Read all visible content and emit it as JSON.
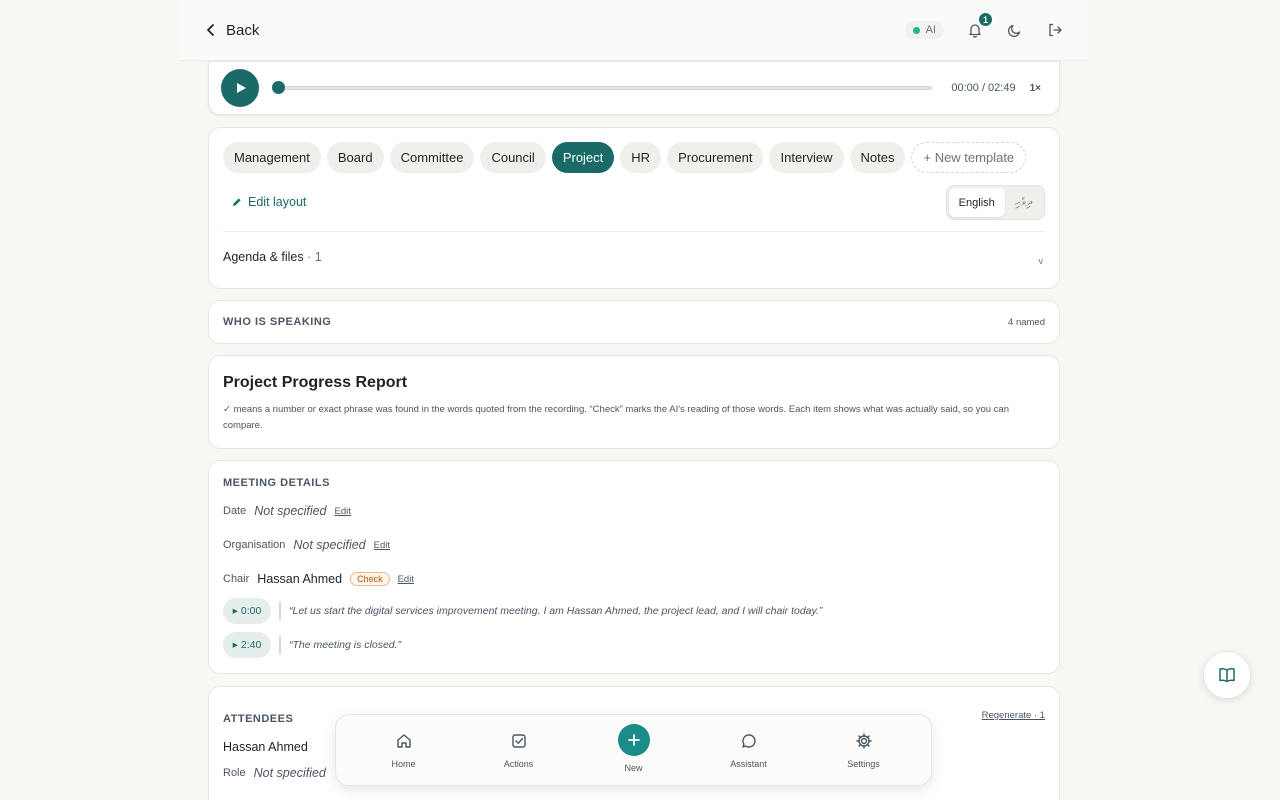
{
  "topbar": {
    "back_label": "Back",
    "ai_label": "AI",
    "notification_count": "1",
    "icons": [
      "bell-icon",
      "moon-icon",
      "logout-icon"
    ]
  },
  "player": {
    "time": "00:00 / 02:49",
    "speed": "1×",
    "progress": 0
  },
  "templates": {
    "chips": [
      "Management",
      "Board",
      "Committee",
      "Council",
      "Project",
      "HR",
      "Procurement",
      "Interview",
      "Notes"
    ],
    "active": "Project",
    "new_template": "+ New template",
    "edit_layout": "Edit layout",
    "languages": [
      "English",
      "ދިވެހި"
    ],
    "selected_language": "English",
    "agenda_label": "Agenda & files",
    "agenda_count": "· 1",
    "agenda_caret": "v"
  },
  "speaking": {
    "title": "WHO IS SPEAKING",
    "count": "4 named"
  },
  "report": {
    "title": "Project Progress Report",
    "note": "✓ means a number or exact phrase was found in the words quoted from the recording. “Check” marks the AI's reading of those words. Each item shows what was actually said, so you can compare."
  },
  "details": {
    "title": "MEETING DETAILS",
    "date_label": "Date",
    "date_value": "Not specified",
    "org_label": "Organisation",
    "org_value": "Not specified",
    "chair_label": "Chair",
    "chair_value": "Hassan Ahmed",
    "check_label": "Check",
    "edit_label": "Edit",
    "quotes": [
      {
        "time": "0:00",
        "text": "“Let us start the digital services improvement meeting. I am Hassan Ahmed, the project lead, and I will chair today.”"
      },
      {
        "time": "2:40",
        "text": "“The meeting is closed.”"
      }
    ]
  },
  "attendees": {
    "title": "ATTENDEES",
    "regenerate": "Regenerate · 1",
    "name": "Hassan Ahmed",
    "role_label": "Role",
    "role_value": "Not specified"
  },
  "nav": {
    "items": [
      {
        "label": "Home",
        "icon": "home-icon"
      },
      {
        "label": "Actions",
        "icon": "checkbox-icon"
      },
      {
        "label": "New",
        "icon": "plus-icon"
      },
      {
        "label": "Assistant",
        "icon": "chat-icon"
      },
      {
        "label": "Settings",
        "icon": "gear-icon"
      }
    ]
  },
  "colors": {
    "accent": "#1a6b68",
    "background": "#f7f7f4",
    "ai_status": "#1fb886"
  }
}
